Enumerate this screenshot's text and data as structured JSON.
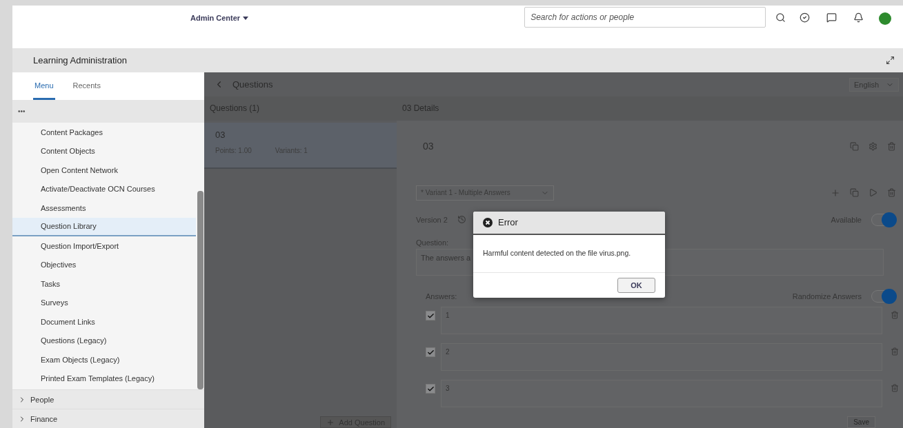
{
  "header": {
    "title": "Admin Center",
    "search": {
      "placeholder": "Search for actions or people"
    }
  },
  "app_bar": {
    "title": "Learning Administration"
  },
  "sidebar": {
    "tabs": [
      {
        "label": "Menu",
        "selected": true
      },
      {
        "label": "Recents",
        "selected": false
      }
    ],
    "more": "•••",
    "items": [
      {
        "label": "Content Packages",
        "selected": false
      },
      {
        "label": "Content Objects",
        "selected": false
      },
      {
        "label": "Open Content Network",
        "selected": false
      },
      {
        "label": "Activate/Deactivate OCN Courses",
        "selected": false
      },
      {
        "label": "Assessments",
        "selected": false
      },
      {
        "label": "Question Library",
        "selected": true
      },
      {
        "label": "Question Import/Export",
        "selected": false
      },
      {
        "label": "Objectives",
        "selected": false
      },
      {
        "label": "Tasks",
        "selected": false
      },
      {
        "label": "Surveys",
        "selected": false
      },
      {
        "label": "Document Links",
        "selected": false
      },
      {
        "label": "Questions (Legacy)",
        "selected": false
      },
      {
        "label": "Exam Objects (Legacy)",
        "selected": false
      },
      {
        "label": "Printed Exam Templates (Legacy)",
        "selected": false
      }
    ],
    "groups": [
      {
        "label": "People",
        "expanded": false
      },
      {
        "label": "Finance",
        "expanded": false
      }
    ]
  },
  "page": {
    "title": "Questions",
    "language": "English"
  },
  "questions": {
    "heading": "Questions (1)",
    "items": [
      {
        "title": "03",
        "points": "Points: 1.00",
        "variants": "Variants: 1",
        "selected": true
      }
    ],
    "add_button": "Add Question"
  },
  "details": {
    "heading": "03 Details",
    "title": "03",
    "variant": "* Variant 1 - Multiple Answers",
    "version": "Version 2",
    "available": {
      "label": "Available",
      "on": true
    },
    "question_label": "Question:",
    "question_text": "The answers a",
    "answers_label": "Answers:",
    "randomize": {
      "label": "Randomize Answers",
      "on": true
    },
    "answers": [
      {
        "text": "1",
        "checked": true
      },
      {
        "text": "2",
        "checked": true
      },
      {
        "text": "3",
        "checked": true
      }
    ],
    "save": "Save"
  },
  "dialog": {
    "title": "Error",
    "message": "Harmful content detected on the file virus.png.",
    "button": "OK"
  }
}
